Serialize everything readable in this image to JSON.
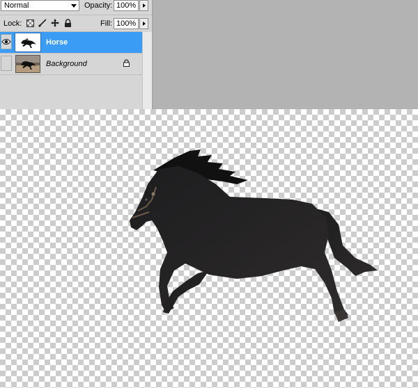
{
  "layers_panel": {
    "blend_mode": "Normal",
    "opacity_label": "Opacity:",
    "opacity_value": "100%",
    "lock_label": "Lock:",
    "fill_label": "Fill:",
    "fill_value": "100%",
    "lock_icons": [
      "lock-transparent-pixels-icon",
      "lock-image-pixels-icon",
      "lock-position-icon",
      "lock-all-icon"
    ],
    "layers": [
      {
        "name": "Horse",
        "selected": true,
        "visible": true,
        "locked": false
      },
      {
        "name": "Background",
        "selected": false,
        "visible": false,
        "locked": true
      }
    ],
    "accent_color": "#3b9cf5"
  },
  "canvas": {
    "content": "horse-silhouette",
    "background": "transparency-checkerboard"
  }
}
